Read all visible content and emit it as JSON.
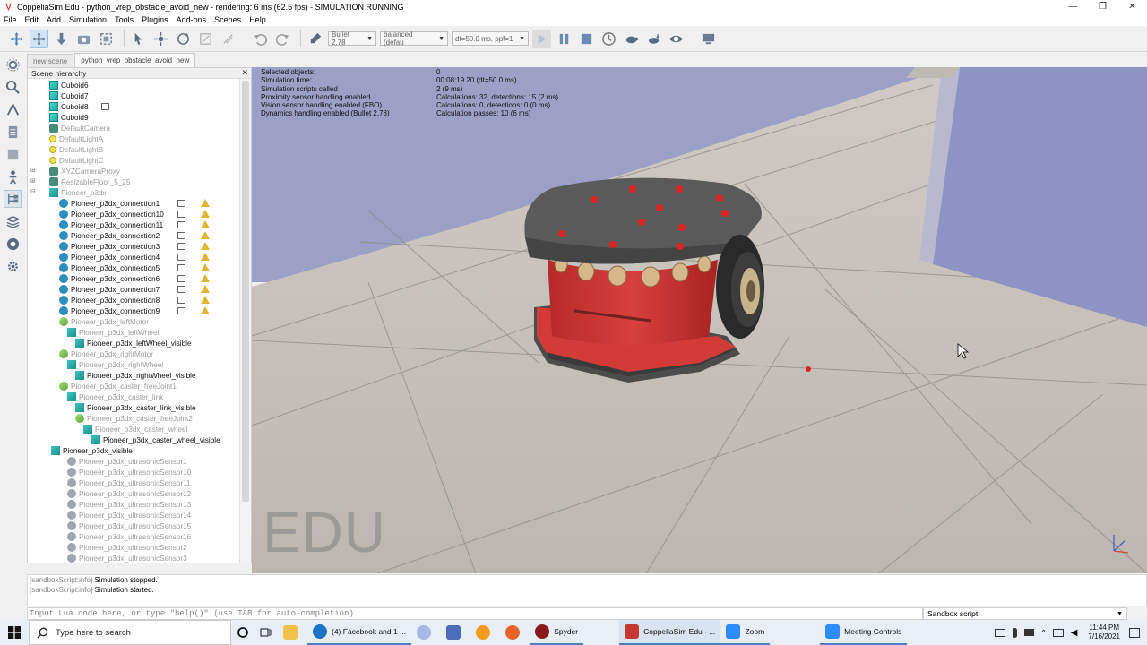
{
  "window": {
    "title": "CoppeliaSim Edu - python_vrep_obstacle_avoid_new - rendering: 6 ms (62.5 fps) - SIMULATION RUNNING",
    "minimize": "—",
    "maximize": "❐",
    "close": "✕"
  },
  "menu": [
    "File",
    "Edit",
    "Add",
    "Simulation",
    "Tools",
    "Plugins",
    "Add-ons",
    "Scenes",
    "Help"
  ],
  "toolbar": {
    "engine": "Bullet 2.78",
    "accuracy": "balanced (defau",
    "timestep": "dt=50.0 ms, ppf=1"
  },
  "tabs": [
    "new scene",
    "python_vrep_obstacle_avoid_new"
  ],
  "hierarchy": {
    "title": "Scene hierarchy",
    "close": "✕",
    "items": [
      {
        "label": "Cuboid6",
        "icon": "cuboid-icon",
        "grey": false
      },
      {
        "label": "Cuboid7",
        "icon": "cuboid-icon",
        "grey": false
      },
      {
        "label": "Cuboid8",
        "icon": "cuboid-icon",
        "grey": false
      },
      {
        "label": "Cuboid9",
        "icon": "cuboid-icon",
        "grey": false
      },
      {
        "label": "DefaultCamera",
        "icon": "camera-icon",
        "grey": true
      },
      {
        "label": "DefaultLightA",
        "icon": "light-icon",
        "grey": true
      },
      {
        "label": "DefaultLightB",
        "icon": "light-icon",
        "grey": true
      },
      {
        "label": "DefaultLightC",
        "icon": "light-icon",
        "grey": true
      },
      {
        "label": "XYZCameraProxy",
        "icon": "proxy-icon",
        "grey": true
      },
      {
        "label": "ResizableFloor_5_25",
        "icon": "floor-icon",
        "grey": true
      },
      {
        "label": "Pioneer_p3dx",
        "icon": "robot-icon",
        "grey": true
      },
      {
        "label": "Pioneer_p3dx_connection1",
        "icon": "dummy-icon",
        "grey": false
      },
      {
        "label": "Pioneer_p3dx_connection10",
        "icon": "dummy-icon",
        "grey": false
      },
      {
        "label": "Pioneer_p3dx_connection11",
        "icon": "dummy-icon",
        "grey": false
      },
      {
        "label": "Pioneer_p3dx_connection2",
        "icon": "dummy-icon",
        "grey": false
      },
      {
        "label": "Pioneer_p3dx_connection3",
        "icon": "dummy-icon",
        "grey": false
      },
      {
        "label": "Pioneer_p3dx_connection4",
        "icon": "dummy-icon",
        "grey": false
      },
      {
        "label": "Pioneer_p3dx_connection5",
        "icon": "dummy-icon",
        "grey": false
      },
      {
        "label": "Pioneer_p3dx_connection6",
        "icon": "dummy-icon",
        "grey": false
      },
      {
        "label": "Pioneer_p3dx_connection7",
        "icon": "dummy-icon",
        "grey": false
      },
      {
        "label": "Pioneer_p3dx_connection8",
        "icon": "dummy-icon",
        "grey": false
      },
      {
        "label": "Pioneer_p3dx_connection9",
        "icon": "dummy-icon",
        "grey": false
      },
      {
        "label": "Pioneer_p3dx_leftMotor",
        "icon": "joint-icon",
        "grey": true
      },
      {
        "label": "Pioneer_p3dx_leftWheel",
        "icon": "shape-icon",
        "grey": true
      },
      {
        "label": "Pioneer_p3dx_leftWheel_visible",
        "icon": "shape-icon",
        "grey": false
      },
      {
        "label": "Pioneer_p3dx_rightMotor",
        "icon": "joint-icon",
        "grey": true
      },
      {
        "label": "Pioneer_p3dx_rightWheel",
        "icon": "shape-icon",
        "grey": true
      },
      {
        "label": "Pioneer_p3dx_rightWheel_visible",
        "icon": "shape-icon",
        "grey": false
      },
      {
        "label": "Pioneer_p3dx_caster_freeJoint1",
        "icon": "joint-icon",
        "grey": true
      },
      {
        "label": "Pioneer_p3dx_caster_link",
        "icon": "shape-icon",
        "grey": true
      },
      {
        "label": "Pioneer_p3dx_caster_link_visible",
        "icon": "shape-icon",
        "grey": false
      },
      {
        "label": "Pioneer_p3dx_caster_freeJoint2",
        "icon": "joint-icon",
        "grey": true
      },
      {
        "label": "Pioneer_p3dx_caster_wheel",
        "icon": "shape-icon",
        "grey": true
      },
      {
        "label": "Pioneer_p3dx_caster_wheel_visible",
        "icon": "shape-icon",
        "grey": false
      },
      {
        "label": "Pioneer_p3dx_visible",
        "icon": "shape-icon",
        "grey": false
      },
      {
        "label": "Pioneer_p3dx_ultrasonicSensor1",
        "icon": "sensor-icon",
        "grey": true
      },
      {
        "label": "Pioneer_p3dx_ultrasonicSensor10",
        "icon": "sensor-icon",
        "grey": true
      },
      {
        "label": "Pioneer_p3dx_ultrasonicSensor11",
        "icon": "sensor-icon",
        "grey": true
      },
      {
        "label": "Pioneer_p3dx_ultrasonicSensor12",
        "icon": "sensor-icon",
        "grey": true
      },
      {
        "label": "Pioneer_p3dx_ultrasonicSensor13",
        "icon": "sensor-icon",
        "grey": true
      },
      {
        "label": "Pioneer_p3dx_ultrasonicSensor14",
        "icon": "sensor-icon",
        "grey": true
      },
      {
        "label": "Pioneer_p3dx_ultrasonicSensor15",
        "icon": "sensor-icon",
        "grey": true
      },
      {
        "label": "Pioneer_p3dx_ultrasonicSensor16",
        "icon": "sensor-icon",
        "grey": true
      },
      {
        "label": "Pioneer_p3dx_ultrasonicSensor2",
        "icon": "sensor-icon",
        "grey": true
      },
      {
        "label": "Pioneer_p3dx_ultrasonicSensor3",
        "icon": "sensor-icon",
        "grey": true
      }
    ]
  },
  "viewport": {
    "info_labels": [
      "Selected objects:",
      "Simulation time:",
      "Simulation scripts called",
      "Proximity sensor handling enabled",
      "Vision sensor handling enabled (FBO)",
      "Dynamics handling enabled (Bullet 2.78)"
    ],
    "info_values": [
      "0",
      "00:08:19.20 (dt=50.0 ms)",
      "2 (9 ms)",
      "Calculations: 32, detections: 15 (2 ms)",
      "Calculations: 0, detections: 0 (0 ms)",
      "Calculation passes: 10 (6 ms)"
    ],
    "watermark": "EDU"
  },
  "console": {
    "lines": [
      {
        "prefix": "[sandboxScript:info]",
        "text": "Simulation stopped."
      },
      {
        "prefix": "[sandboxScript:info]",
        "text": "Simulation started."
      }
    ],
    "input_placeholder": "Input Lua code here, or type \"help()\" (use TAB for auto-completion)",
    "script_selector": "Sandbox script"
  },
  "taskbar": {
    "search_placeholder": "Type here to search",
    "apps": [
      {
        "label": "(4) Facebook and 1 ...",
        "color": "#1a73c9"
      },
      {
        "label": "Spyder",
        "color": "#8b1a1a"
      },
      {
        "label": "CoppeliaSim Edu - ...",
        "color": "#c7372f"
      },
      {
        "label": "Zoom",
        "color": "#2d8cff"
      },
      {
        "label": "Meeting Controls",
        "color": "#2d8cff"
      }
    ],
    "time": "11:44 PM",
    "date": "7/16/2021"
  }
}
